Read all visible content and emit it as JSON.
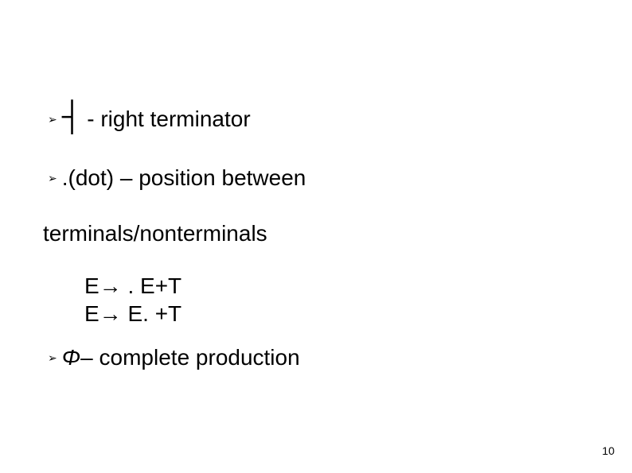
{
  "bullets": {
    "glyph": "➢",
    "item1": {
      "symbol": "┤",
      "text": " - right terminator"
    },
    "item2": {
      "symbol": ". ",
      "text": "(dot) – position between"
    },
    "continuation": "terminals/nonterminals",
    "examples": {
      "line1": "E→ . E+T",
      "line2": "E→ E. +T"
    },
    "item3": {
      "symbol": "Φ",
      "text": " – complete production"
    }
  },
  "page_number": "10"
}
